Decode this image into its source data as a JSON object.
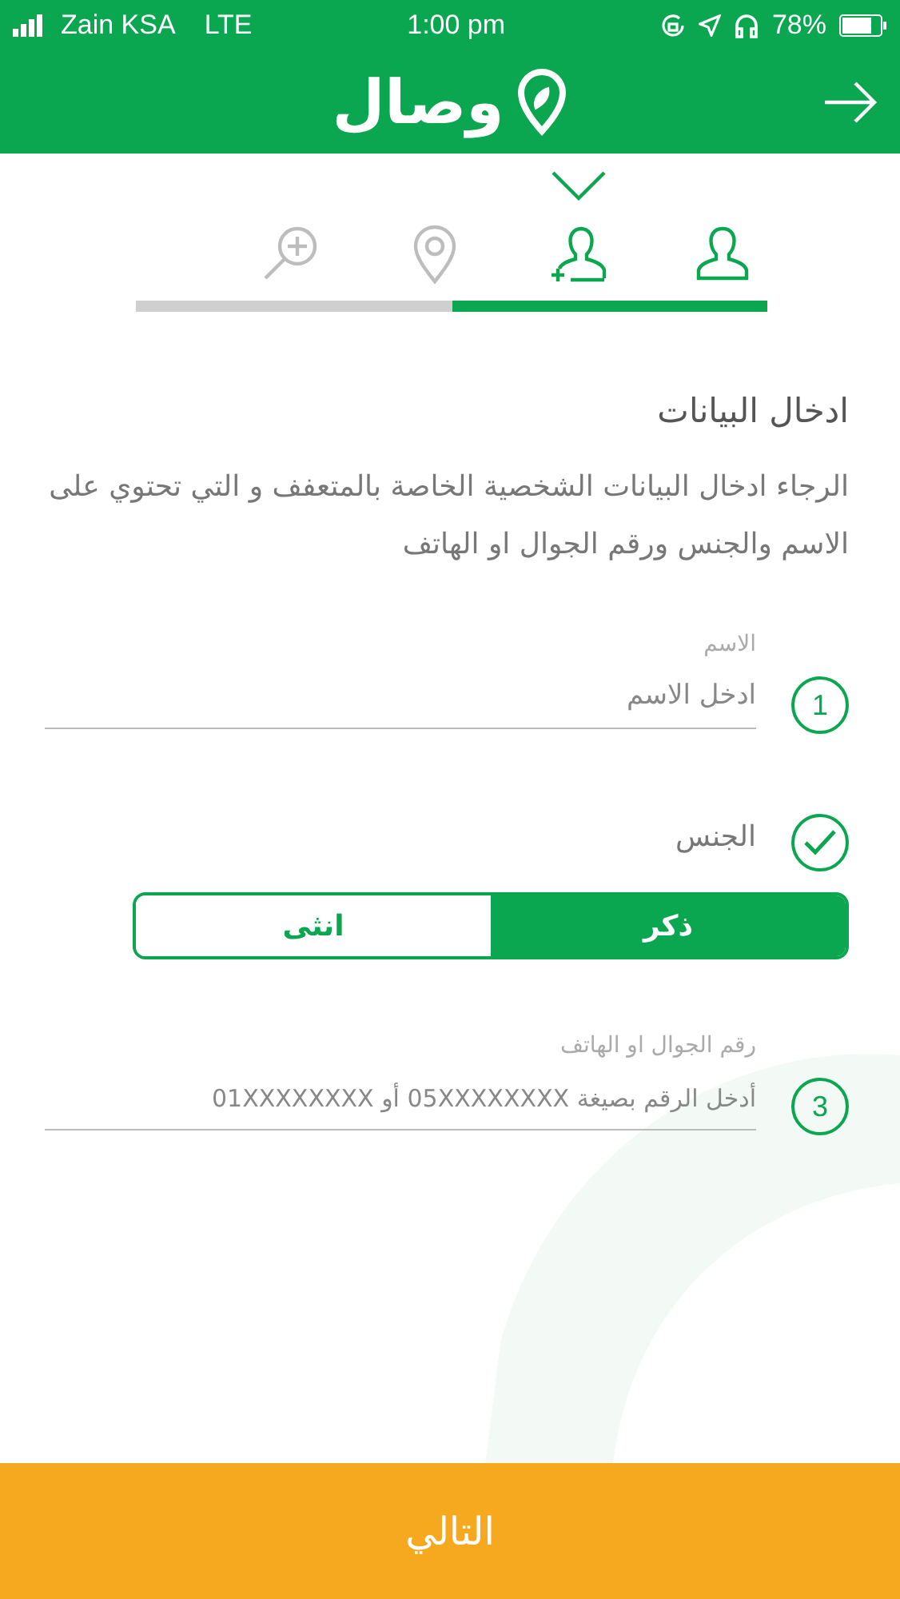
{
  "status_bar": {
    "carrier": "Zain KSA",
    "network": "LTE",
    "time": "1:00 pm",
    "battery": "78%"
  },
  "header": {
    "logo_text": "وصال"
  },
  "steps": [
    {
      "kind": "person",
      "selected": false
    },
    {
      "kind": "person-add",
      "selected": true
    },
    {
      "kind": "location",
      "selected": false
    },
    {
      "kind": "search-plus",
      "selected": false
    }
  ],
  "progress": {
    "level": 0.5
  },
  "title": "ادخال البيانات",
  "description": "الرجاء ادخال البيانات الشخصية الخاصة بالمتعفف و التي تحتوي على الاسم والجنس ورقم الجوال او الهاتف",
  "fields": [
    {
      "kind": "text",
      "number": "1",
      "completed": false,
      "label": "الاسم",
      "placeholder": "ادخل الاسم"
    },
    {
      "kind": "choice",
      "completed": true,
      "label": "الجنس",
      "options": [
        {
          "label": "ذكر",
          "selected": true
        },
        {
          "label": "انثى",
          "selected": false
        }
      ]
    },
    {
      "kind": "text",
      "number": "3",
      "completed": false,
      "label": "رقم الجوال او الهاتف",
      "placeholder": "أدخل الرقم بصيغة 05XXXXXXXX  أو 01XXXXXXXX"
    }
  ],
  "next_button": "التالي"
}
